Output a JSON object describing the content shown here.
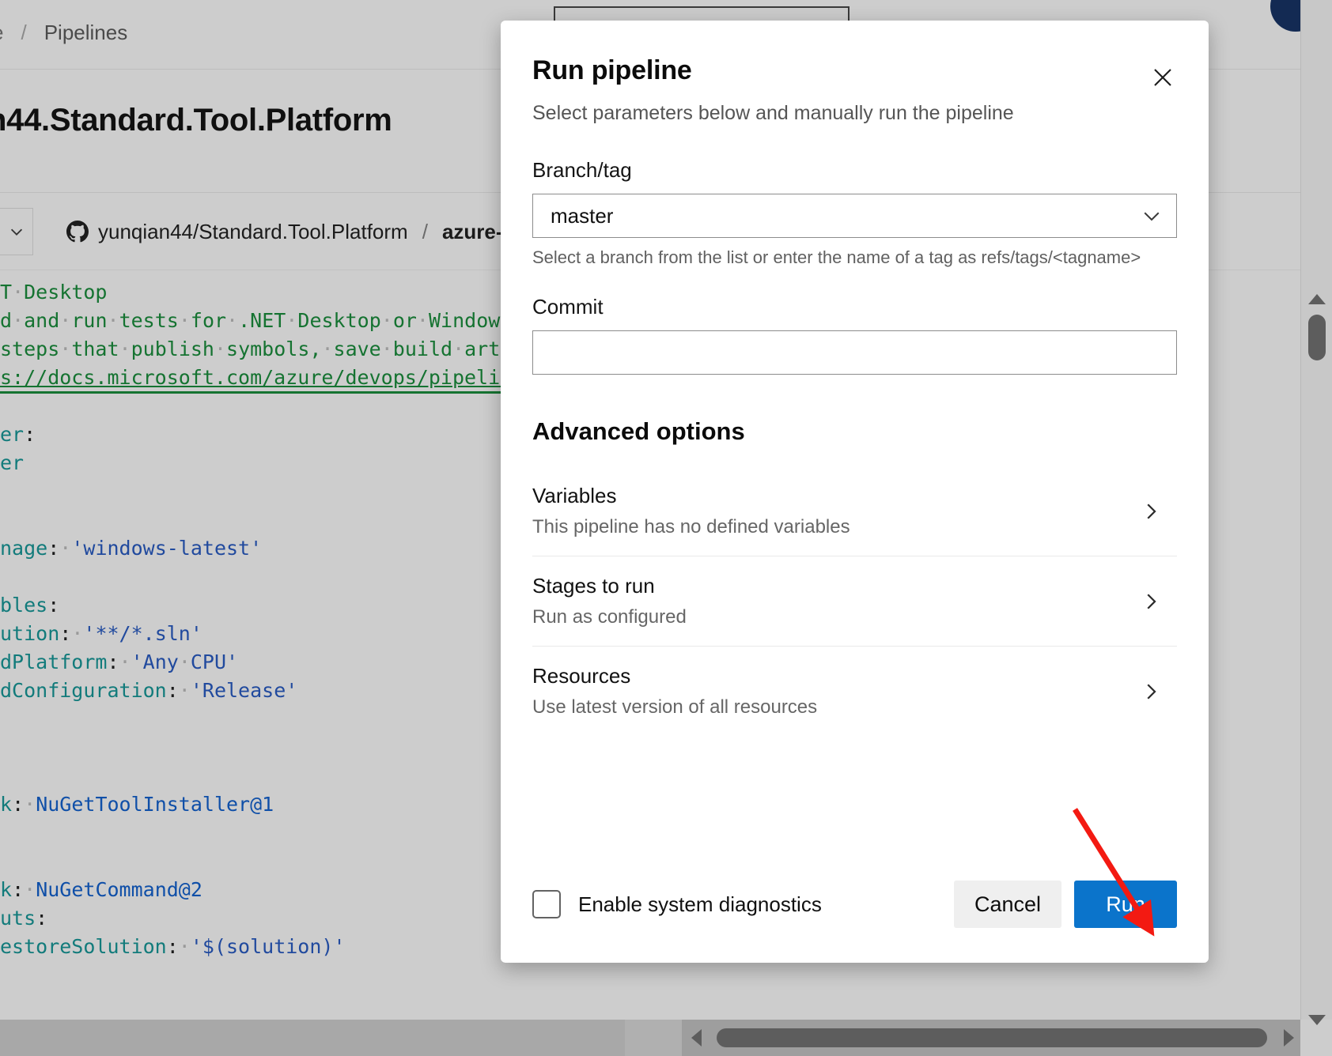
{
  "background": {
    "breadcrumb": {
      "truncated_crumb": "e",
      "separator": "/",
      "current": "Pipelines"
    },
    "page_title": "n44.Standard.Tool.Platform",
    "repo": {
      "icon": "github-icon",
      "name": "yunqian44/Standard.Tool.Platform",
      "separator": "/",
      "file": "azure-p"
    },
    "yaml_lines": [
      [
        {
          "t": "cm",
          "s": "T"
        },
        {
          "t": "dot",
          "s": "·"
        },
        {
          "t": "cm",
          "s": "Desktop"
        }
      ],
      [
        {
          "t": "cm",
          "s": "d"
        },
        {
          "t": "dot",
          "s": "·"
        },
        {
          "t": "cm",
          "s": "and"
        },
        {
          "t": "dot",
          "s": "·"
        },
        {
          "t": "cm",
          "s": "run"
        },
        {
          "t": "dot",
          "s": "·"
        },
        {
          "t": "cm",
          "s": "tests"
        },
        {
          "t": "dot",
          "s": "·"
        },
        {
          "t": "cm",
          "s": "for"
        },
        {
          "t": "dot",
          "s": "·"
        },
        {
          "t": "cm",
          "s": ".NET"
        },
        {
          "t": "dot",
          "s": "·"
        },
        {
          "t": "cm",
          "s": "Desktop"
        },
        {
          "t": "dot",
          "s": "·"
        },
        {
          "t": "cm",
          "s": "or"
        },
        {
          "t": "dot",
          "s": "·"
        },
        {
          "t": "cm",
          "s": "Windows"
        },
        {
          "t": "dot",
          "s": "·"
        }
      ],
      [
        {
          "t": "cm",
          "s": "steps"
        },
        {
          "t": "dot",
          "s": "·"
        },
        {
          "t": "cm",
          "s": "that"
        },
        {
          "t": "dot",
          "s": "·"
        },
        {
          "t": "cm",
          "s": "publish"
        },
        {
          "t": "dot",
          "s": "·"
        },
        {
          "t": "cm",
          "s": "symbols,"
        },
        {
          "t": "dot",
          "s": "·"
        },
        {
          "t": "cm",
          "s": "save"
        },
        {
          "t": "dot",
          "s": "·"
        },
        {
          "t": "cm",
          "s": "build"
        },
        {
          "t": "dot",
          "s": "·"
        },
        {
          "t": "cm",
          "s": "artif"
        }
      ],
      [
        {
          "t": "cm-u",
          "s": "s://docs.microsoft.com/azure/devops/pipeline"
        }
      ],
      [],
      [
        {
          "t": "key",
          "s": "er"
        },
        {
          "t": "pun",
          "s": ":"
        }
      ],
      [
        {
          "t": "key",
          "s": "er"
        }
      ],
      [],
      [],
      [
        {
          "t": "key",
          "s": "nage"
        },
        {
          "t": "pun",
          "s": ":"
        },
        {
          "t": "dot",
          "s": "·"
        },
        {
          "t": "str",
          "s": "'windows-latest'"
        }
      ],
      [],
      [
        {
          "t": "key",
          "s": "bles"
        },
        {
          "t": "pun",
          "s": ":"
        }
      ],
      [
        {
          "t": "key",
          "s": "ution"
        },
        {
          "t": "pun",
          "s": ":"
        },
        {
          "t": "dot",
          "s": "·"
        },
        {
          "t": "str",
          "s": "'**/*.sln'"
        }
      ],
      [
        {
          "t": "key",
          "s": "dPlatform"
        },
        {
          "t": "pun",
          "s": ":"
        },
        {
          "t": "dot",
          "s": "·"
        },
        {
          "t": "str",
          "s": "'Any"
        },
        {
          "t": "dot",
          "s": "·"
        },
        {
          "t": "str",
          "s": "CPU'"
        }
      ],
      [
        {
          "t": "key",
          "s": "dConfiguration"
        },
        {
          "t": "pun",
          "s": ":"
        },
        {
          "t": "dot",
          "s": "·"
        },
        {
          "t": "str",
          "s": "'Release'"
        }
      ],
      [],
      [],
      [],
      [
        {
          "t": "key",
          "s": "k"
        },
        {
          "t": "pun",
          "s": ":"
        },
        {
          "t": "dot",
          "s": "·"
        },
        {
          "t": "type",
          "s": "NuGetToolInstaller@1"
        }
      ],
      [],
      [],
      [
        {
          "t": "key",
          "s": "k"
        },
        {
          "t": "pun",
          "s": ":"
        },
        {
          "t": "dot",
          "s": "·"
        },
        {
          "t": "type",
          "s": "NuGetCommand@2"
        }
      ],
      [
        {
          "t": "key",
          "s": "uts"
        },
        {
          "t": "pun",
          "s": ":"
        }
      ],
      [
        {
          "t": "key",
          "s": "estoreSolution"
        },
        {
          "t": "pun",
          "s": ":"
        },
        {
          "t": "dot",
          "s": "·"
        },
        {
          "t": "str",
          "s": "'$(solution)'"
        }
      ]
    ]
  },
  "dialog": {
    "title": "Run pipeline",
    "subtitle": "Select parameters below and manually run the pipeline",
    "close_icon": "close-icon",
    "branch": {
      "label": "Branch/tag",
      "value": "master",
      "placeholder": "",
      "help": "Select a branch from the list or enter the name of a tag as refs/tags/<tagname>",
      "chevron_icon": "chevron-down-icon"
    },
    "commit": {
      "label": "Commit",
      "value": "",
      "placeholder": ""
    },
    "advanced": {
      "title": "Advanced options",
      "rows": [
        {
          "name": "Variables",
          "desc": "This pipeline has no defined variables",
          "chevron_icon": "chevron-right-icon"
        },
        {
          "name": "Stages to run",
          "desc": "Run as configured",
          "chevron_icon": "chevron-right-icon"
        },
        {
          "name": "Resources",
          "desc": "Use latest version of all resources",
          "chevron_icon": "chevron-right-icon"
        }
      ]
    },
    "footer": {
      "diagnostics_label": "Enable system diagnostics",
      "diagnostics_checked": false,
      "cancel_label": "Cancel",
      "run_label": "Run"
    }
  },
  "annotation": {
    "arrow_color": "#f31a12",
    "points_to": "Run"
  },
  "colors": {
    "primary_button": "#0b74cb",
    "page_background": "#cdcdcd",
    "dialog_background": "#ffffff",
    "annotation_red": "#f31a12",
    "yaml_comment_green": "#157331",
    "yaml_string_blue": "#214a9e",
    "yaml_key_teal": "#127b7b"
  }
}
